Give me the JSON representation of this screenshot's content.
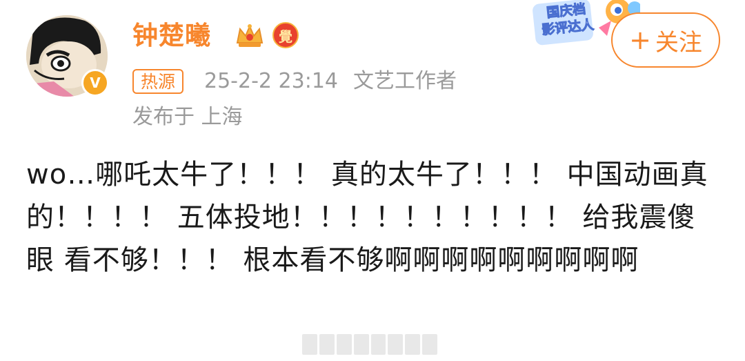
{
  "author": {
    "name": "钟楚曦",
    "verified": true
  },
  "meta": {
    "hot_tag": "热源",
    "datetime": "25-2-2 23:14",
    "identity": "文艺工作者",
    "location": "发布于 上海"
  },
  "event_sticker": {
    "line1": "国庆档",
    "line2": "影评达人"
  },
  "follow_button": {
    "label": "关注",
    "icon": "plus-icon"
  },
  "badges": {
    "vip_label": "覺"
  },
  "post": {
    "text": "wo…哪吒太牛了！！！ 真的太牛了！！！ 中国动画真的！！！！ 五体投地！！！！！！！！！！ 给我震傻眼 看不够！！！ 根本看不够啊啊啊啊啊啊啊啊啊"
  },
  "colors": {
    "accent": "#f7862d",
    "meta_gray": "#9a9a9a",
    "text": "#1a1a1a"
  }
}
